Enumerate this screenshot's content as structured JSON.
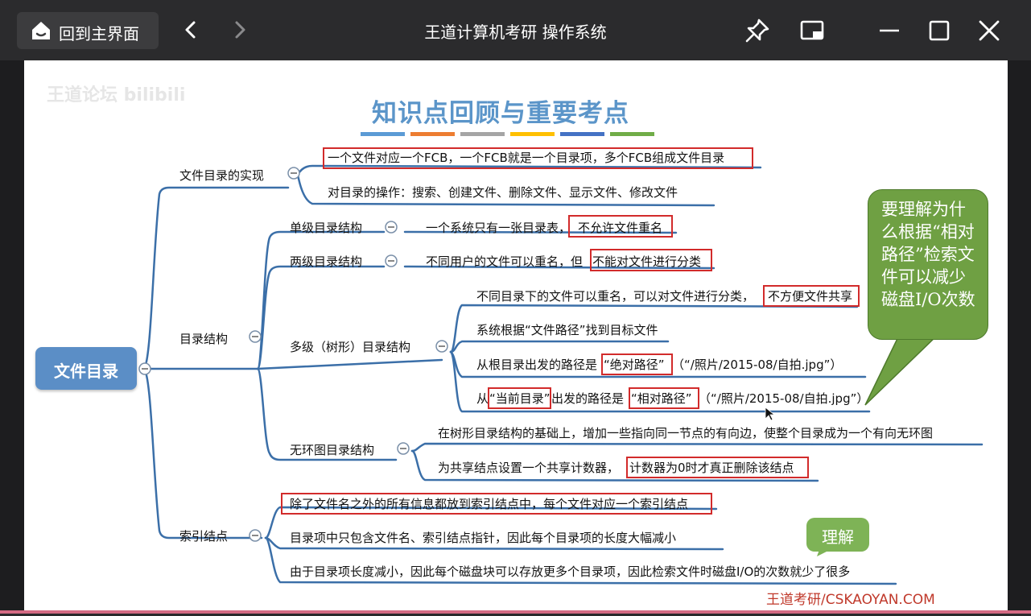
{
  "app": {
    "home_label": "回到主界面",
    "window_title": "王道计算机考研 操作系统"
  },
  "slide": {
    "watermark": "王道论坛 bilibili",
    "title": "知识点回顾与重要考点",
    "title_bar_colors": [
      "#5b9bd5",
      "#ed7d31",
      "#a5a5a5",
      "#ffc000",
      "#4472c4",
      "#70ad47"
    ],
    "root": "文件目录",
    "branch_dir_impl": "文件目录的实现",
    "dir_impl_1": "一个文件对应一个FCB，一个FCB就是一个目录项，多个FCB组成文件目录",
    "dir_impl_2": "对目录的操作：搜索、创建文件、删除文件、显示文件、修改文件",
    "branch_dir_struct": "目录结构",
    "single_level": "单级目录结构",
    "single_level_desc_a": "一个系统只有一张目录表，",
    "single_level_desc_b": "不允许文件重名",
    "two_level": "两级目录结构",
    "two_level_desc_a": "不同用户的文件可以重名，但",
    "two_level_desc_b": "不能对文件进行分类",
    "multi_level": "多级（树形）目录结构",
    "multi_1a": "不同目录下的文件可以重名，可以对文件进行分类，",
    "multi_1b": "不方便文件共享",
    "multi_2": "系统根据“文件路径”找到目标文件",
    "multi_3a": "从根目录出发的路径是",
    "multi_3b": "“绝对路径”",
    "multi_3c": "（“/照片/2015-08/自拍.jpg”）",
    "multi_4a": "从",
    "multi_4b": "“当前目录”",
    "multi_4c": "出发的路径是",
    "multi_4d": "“相对路径”",
    "multi_4e": "（“/照片/2015-08/自拍.jpg”）",
    "acyclic": "无环图目录结构",
    "acyclic_1": "在树形目录结构的基础上，增加一些指向同一节点的有向边，使整个目录成为一个有向无环图",
    "acyclic_2a": "为共享结点设置一个共享计数器，",
    "acyclic_2b": "计数器为0时才真正删除该结点",
    "branch_index": "索引结点",
    "index_1": "除了文件名之外的所有信息都放到索引结点中，每个文件对应一个索引结点",
    "index_2": "目录项中只包含文件名、索引结点指针，因此每个目录项的长度大幅减小",
    "index_3": "由于目录项长度减小，因此每个磁盘块可以存放更多个目录项，因此检索文件时磁盘I/O的次数就少了很多",
    "callout_main": "要理解为什么根据“相对路径”检索文件可以减少磁盘I/O次数",
    "callout_small": "理解",
    "footer": "王道考研/CSKAOYAN.COM"
  }
}
